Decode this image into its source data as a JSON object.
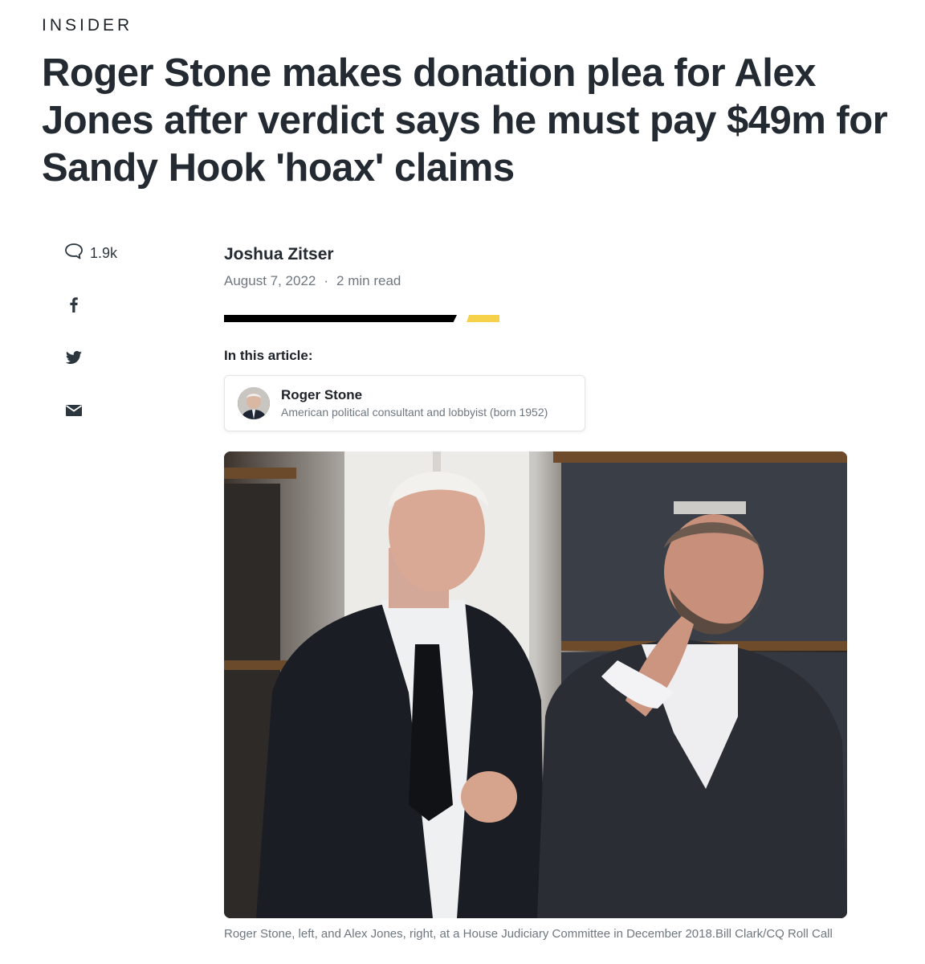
{
  "brand": "INSIDER",
  "headline": "Roger Stone makes donation plea for Alex Jones after verdict says he must pay $49m for Sandy Hook 'hoax' claims",
  "share": {
    "comment_count": "1.9k",
    "icons": [
      "comment-icon",
      "facebook-icon",
      "twitter-icon",
      "email-icon"
    ]
  },
  "byline": {
    "author": "Joshua Zitser",
    "date": "August 7, 2022",
    "separator": "·",
    "read_time": "2 min read"
  },
  "in_article": {
    "heading": "In this article:",
    "entity": {
      "name": "Roger Stone",
      "description": "American political consultant and lobbyist (born 1952)"
    }
  },
  "photo": {
    "caption": "Roger Stone, left, and Alex Jones, right, at a House Judiciary Committee in December 2018.Bill Clark/CQ Roll Call"
  },
  "colors": {
    "accent_yellow": "#f6d14a",
    "text_dark": "#232a31",
    "text_muted": "#6e7780"
  }
}
